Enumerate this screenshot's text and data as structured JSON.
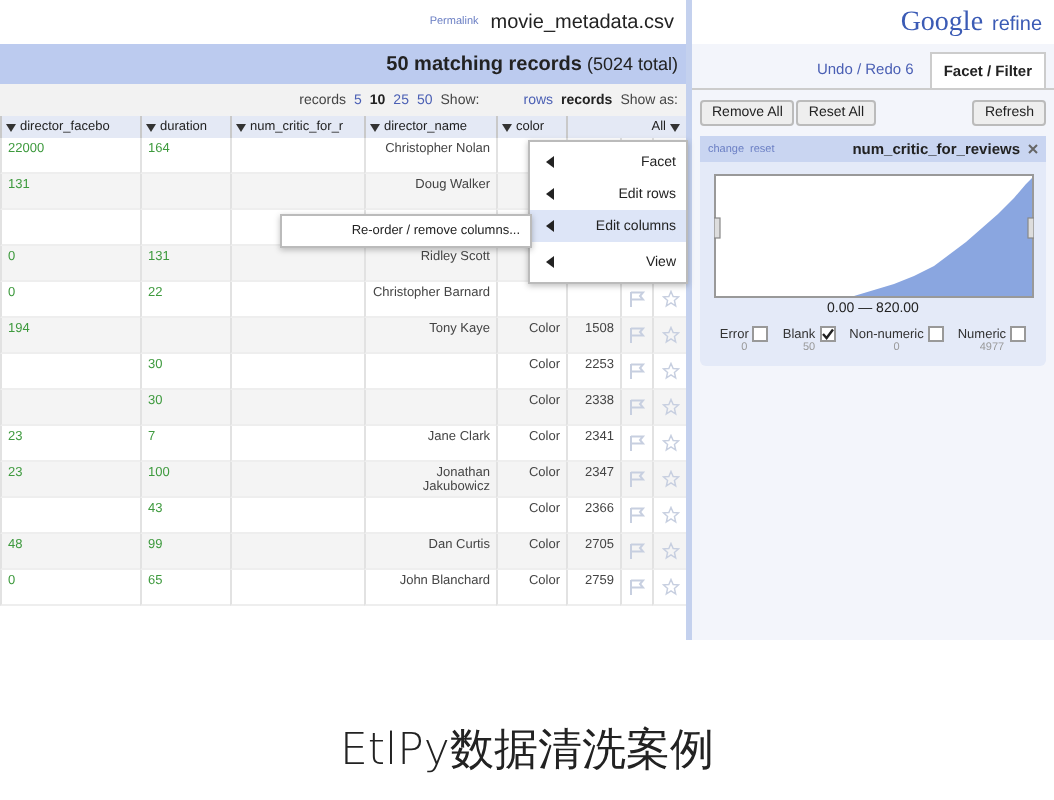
{
  "header": {
    "logo_google": "Google",
    "logo_refine": "refine",
    "project_name": "movie_metadata.csv",
    "permalink": "Permalink"
  },
  "summary": {
    "count": "50 matching records",
    "total": "(5024 total)"
  },
  "show_bar": {
    "show_as_label": "Show as:",
    "modes": [
      {
        "label": "rows",
        "selected": false
      },
      {
        "label": "records",
        "selected": true
      }
    ],
    "show_label": "Show:",
    "page_sizes": [
      {
        "label": "5",
        "selected": false
      },
      {
        "label": "10",
        "selected": true
      },
      {
        "label": "25",
        "selected": false
      },
      {
        "label": "50",
        "selected": false
      }
    ],
    "unit": "records"
  },
  "table": {
    "columns": [
      "director_facebo",
      "duration",
      "num_critic_for_r",
      "director_name",
      "color",
      "All"
    ],
    "rows": [
      {
        "director_facebook": "22000",
        "duration": "164",
        "num_critic": "",
        "director_name": "Christopher Nolan",
        "film_color": "",
        "row_number": ""
      },
      {
        "director_facebook": "131",
        "duration": "",
        "num_critic": "",
        "director_name": "Doug Walker",
        "film_color": "",
        "row_number": ""
      },
      {
        "director_facebook": "",
        "duration": "",
        "num_critic": "",
        "director_name": "",
        "film_color": "",
        "row_number": ""
      },
      {
        "director_facebook": "0",
        "duration": "131",
        "num_critic": "",
        "director_name": "Ridley Scott",
        "film_color": "",
        "row_number": ""
      },
      {
        "director_facebook": "0",
        "duration": "22",
        "num_critic": "",
        "director_name": "Christopher Barnard",
        "film_color": "",
        "row_number": ""
      },
      {
        "director_facebook": "194",
        "duration": "",
        "num_critic": "",
        "director_name": "Tony Kaye",
        "film_color": "Color",
        "row_number": "1508"
      },
      {
        "director_facebook": "",
        "duration": "30",
        "num_critic": "",
        "director_name": "",
        "film_color": "Color",
        "row_number": "2253"
      },
      {
        "director_facebook": "",
        "duration": "30",
        "num_critic": "",
        "director_name": "",
        "film_color": "Color",
        "row_number": "2338"
      },
      {
        "director_facebook": "23",
        "duration": "7",
        "num_critic": "",
        "director_name": "Jane Clark",
        "film_color": "Color",
        "row_number": "2341"
      },
      {
        "director_facebook": "23",
        "duration": "100",
        "num_critic": "",
        "director_name": "Jonathan Jakubowicz",
        "film_color": "Color",
        "row_number": "2347"
      },
      {
        "director_facebook": "",
        "duration": "43",
        "num_critic": "",
        "director_name": "",
        "film_color": "Color",
        "row_number": "2366"
      },
      {
        "director_facebook": "48",
        "duration": "99",
        "num_critic": "",
        "director_name": "Dan Curtis",
        "film_color": "Color",
        "row_number": "2705"
      },
      {
        "director_facebook": "0",
        "duration": "65",
        "num_critic": "",
        "director_name": "John Blanchard",
        "film_color": "Color",
        "row_number": "2759"
      }
    ]
  },
  "column_menu": {
    "items": [
      {
        "label": "Facet",
        "selected": false
      },
      {
        "label": "Edit rows",
        "selected": false
      },
      {
        "label": "Edit columns",
        "selected": true
      },
      {
        "label": "View",
        "selected": false
      }
    ],
    "submenu": [
      "Re-order / remove columns..."
    ]
  },
  "side_panel": {
    "tabs": [
      {
        "label": "Undo / Redo 6",
        "selected": false
      },
      {
        "label": "Facet / Filter",
        "selected": true
      }
    ],
    "refresh": "Refresh",
    "reset_all": "Reset All",
    "remove_all": "Remove All",
    "facet": {
      "title": "num_critic_for_reviews",
      "links": [
        "change",
        "reset"
      ],
      "range": "0.00 — 820.00",
      "choices": [
        {
          "label": "Error",
          "count": "0",
          "checked": false
        },
        {
          "label": "Blank",
          "count": "50",
          "checked": true
        },
        {
          "label": "Non-numeric",
          "count": "0",
          "checked": false
        },
        {
          "label": "Numeric",
          "count": "4977",
          "checked": false
        }
      ]
    }
  },
  "caption": "EtlPy数据清洗案例"
}
